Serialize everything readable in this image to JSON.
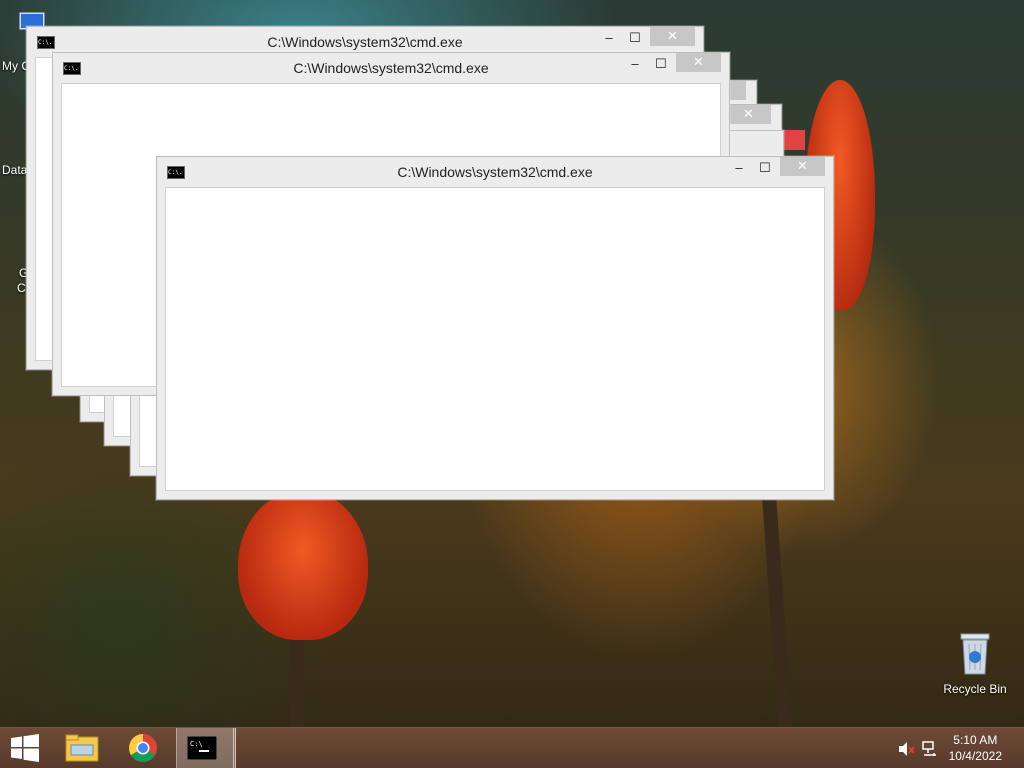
{
  "desktop": {
    "icons": [
      {
        "label": "My C",
        "icon": "computer-icon"
      },
      {
        "label": "Data",
        "icon": "database-shortcut-icon"
      },
      {
        "label_line1": "G",
        "label_line2": "C",
        "icon": "chrome-shortcut-icon"
      },
      {
        "label": "Recycle Bin",
        "icon": "recycle-bin-icon"
      }
    ]
  },
  "windows": [
    {
      "title": "C:\\Windows\\system32\\cmd.exe",
      "minimize": "–",
      "maximize": "☐",
      "close": "✕"
    },
    {
      "title": "C:\\Windows\\system32\\cmd.exe",
      "minimize": "–",
      "maximize": "☐",
      "close": "✕"
    },
    {
      "close": "✕"
    },
    {
      "close": "✕"
    },
    {
      "title": "C:\\Windows\\system32\\cmd.exe",
      "minimize": "–",
      "maximize": "☐",
      "close": "✕"
    }
  ],
  "cmd_icon_text": "C:\\.",
  "taskbar": {
    "start_icon": "windows-logo-icon",
    "items": [
      "file-explorer-icon",
      "chrome-icon",
      "cmd-icon"
    ],
    "tray": [
      "speaker-muted-icon",
      "network-icon"
    ],
    "time": "5:10 AM",
    "date": "10/4/2022"
  },
  "colors": {
    "close_button_inactive": "#c7c7c7",
    "close_button_red": "#e04343",
    "window_frame": "#ececec"
  }
}
